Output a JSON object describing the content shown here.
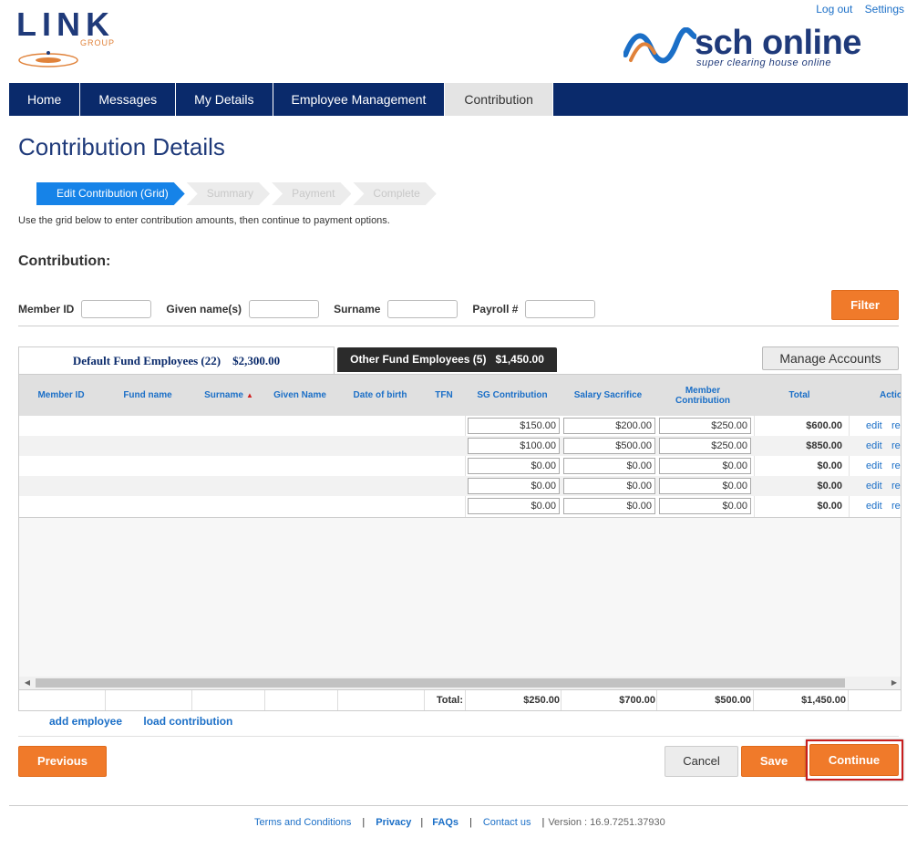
{
  "header": {
    "brand_left": "LINK",
    "brand_left_sub": "GROUP",
    "brand_right": "sch online",
    "brand_right_sub": "super clearing house online",
    "logout": "Log out",
    "settings": "Settings"
  },
  "nav": {
    "items": [
      {
        "label": "Home"
      },
      {
        "label": "Messages"
      },
      {
        "label": "My Details"
      },
      {
        "label": "Employee Management"
      },
      {
        "label": "Contribution"
      }
    ],
    "active_index": 4
  },
  "page_title": "Contribution Details",
  "steps": [
    {
      "label": "Edit Contribution (Grid)",
      "state": "active"
    },
    {
      "label": "Summary",
      "state": "inactive"
    },
    {
      "label": "Payment",
      "state": "inactive"
    },
    {
      "label": "Complete",
      "state": "inactive"
    }
  ],
  "instructions": "Use the grid below to enter contribution amounts, then continue to payment options.",
  "section_title": "Contribution:",
  "filters": {
    "member_id_label": "Member ID",
    "member_id_value": "",
    "given_name_label": "Given name(s)",
    "given_name_value": "",
    "surname_label": "Surname",
    "surname_value": "",
    "payroll_label": "Payroll #",
    "payroll_value": "",
    "filter_button": "Filter"
  },
  "tabs": {
    "default_label": "Default Fund Employees (22)",
    "default_amount": "$2,300.00",
    "other_label": "Other Fund Employees (5)",
    "other_amount": "$1,450.00",
    "manage_accounts": "Manage Accounts"
  },
  "grid": {
    "columns": {
      "member_id": "Member ID",
      "fund_name": "Fund name",
      "surname": "Surname",
      "given_name": "Given Name",
      "dob": "Date of birth",
      "tfn": "TFN",
      "sg": "SG Contribution",
      "salary_sacrifice": "Salary Sacrifice",
      "member_contribution": "Member Contribution",
      "total": "Total",
      "actions": "Actio"
    },
    "rows": [
      {
        "sg": "$150.00",
        "ss": "$200.00",
        "mc": "$250.00",
        "total": "$600.00",
        "edit": "edit",
        "re": "re"
      },
      {
        "sg": "$100.00",
        "ss": "$500.00",
        "mc": "$250.00",
        "total": "$850.00",
        "edit": "edit",
        "re": "re"
      },
      {
        "sg": "$0.00",
        "ss": "$0.00",
        "mc": "$0.00",
        "total": "$0.00",
        "edit": "edit",
        "re": "re"
      },
      {
        "sg": "$0.00",
        "ss": "$0.00",
        "mc": "$0.00",
        "total": "$0.00",
        "edit": "edit",
        "re": "re"
      },
      {
        "sg": "$0.00",
        "ss": "$0.00",
        "mc": "$0.00",
        "total": "$0.00",
        "edit": "edit",
        "re": "re"
      }
    ],
    "footer": {
      "label": "Total:",
      "sg": "$250.00",
      "ss": "$700.00",
      "mc": "$500.00",
      "total": "$1,450.00"
    }
  },
  "grid_links": {
    "add_employee": "add employee",
    "load_contribution": "load contribution"
  },
  "buttons": {
    "previous": "Previous",
    "cancel": "Cancel",
    "save": "Save",
    "continue": "Continue"
  },
  "footer": {
    "terms": "Terms and Conditions",
    "privacy": "Privacy",
    "faqs": "FAQs",
    "contact": "Contact us",
    "version": "Version : 16.9.7251.37930"
  },
  "colors": {
    "navy": "#0a2a6b",
    "orange": "#f07a2a",
    "step_active": "#1683e8",
    "link_blue": "#1b6fc7",
    "highlight_red": "#c81e1e"
  }
}
